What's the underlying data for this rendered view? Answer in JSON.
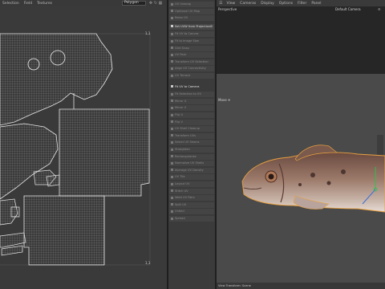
{
  "uv_editor": {
    "menu": [
      "Selection",
      "Field",
      "Textures"
    ],
    "mode_select": "Polygon",
    "toolbar_icons": [
      "move-icon",
      "rotate-icon",
      "grid-icon",
      "settings-icon",
      "close-icon"
    ],
    "coords": {
      "top": "1,1",
      "bottom": "1,1"
    }
  },
  "commands": [
    {
      "label": "UV Unwrap",
      "bright": false
    },
    {
      "label": "Optimize UV Map",
      "bright": false
    },
    {
      "label": "Relax UV",
      "bright": false
    },
    {
      "label": "Set UVW from Projection",
      "bright": true,
      "gear": true
    },
    {
      "label": "Fit UV to Canvas",
      "bright": false
    },
    {
      "label": "Fit to Image Size",
      "bright": false
    },
    {
      "label": "Grid Snap",
      "bright": false
    },
    {
      "label": "UV Pack",
      "bright": false
    },
    {
      "label": "Transform UV Selection",
      "bright": false
    },
    {
      "label": "Align UV Connectivity",
      "bright": false
    },
    {
      "label": "UV Terrace",
      "bright": false
    },
    {
      "label": "Fit UV to Camera",
      "bright": true,
      "header": true
    },
    {
      "label": "Fit Selection to UV",
      "bright": false
    },
    {
      "label": "Mirror U",
      "bright": false
    },
    {
      "label": "Mirror V",
      "bright": false
    },
    {
      "label": "Flip U",
      "bright": false
    },
    {
      "label": "Flip V",
      "bright": false
    },
    {
      "label": "UV Shell Cleanup",
      "bright": false
    },
    {
      "label": "Transform UVs",
      "bright": false
    },
    {
      "label": "Select UV Seams",
      "bright": false
    },
    {
      "label": "Straighten",
      "bright": false
    },
    {
      "label": "Rectangularize",
      "bright": false
    },
    {
      "label": "Normalize UV Shells",
      "bright": false
    },
    {
      "label": "Average UV Density",
      "bright": false
    },
    {
      "label": "UV Tile",
      "bright": false
    },
    {
      "label": "Layout UV",
      "bright": false
    },
    {
      "label": "Stitch UV",
      "bright": false
    },
    {
      "label": "Weld UV Pairs",
      "bright": false
    },
    {
      "label": "Split UV",
      "bright": false
    },
    {
      "label": "Unfold",
      "bright": false
    },
    {
      "label": "Spread",
      "bright": false
    }
  ],
  "viewport": {
    "menu": [
      "View",
      "Cameras",
      "Display",
      "Options",
      "Filter",
      "Panel"
    ],
    "label": "Perspective",
    "camera": "Default Camera",
    "move_label": "Move",
    "status": "View Transform: Scene"
  },
  "colors": {
    "accent_green": "#2fbf4f",
    "accent_blue": "#3a6ed8",
    "mesh_orange": "#e8a040"
  }
}
